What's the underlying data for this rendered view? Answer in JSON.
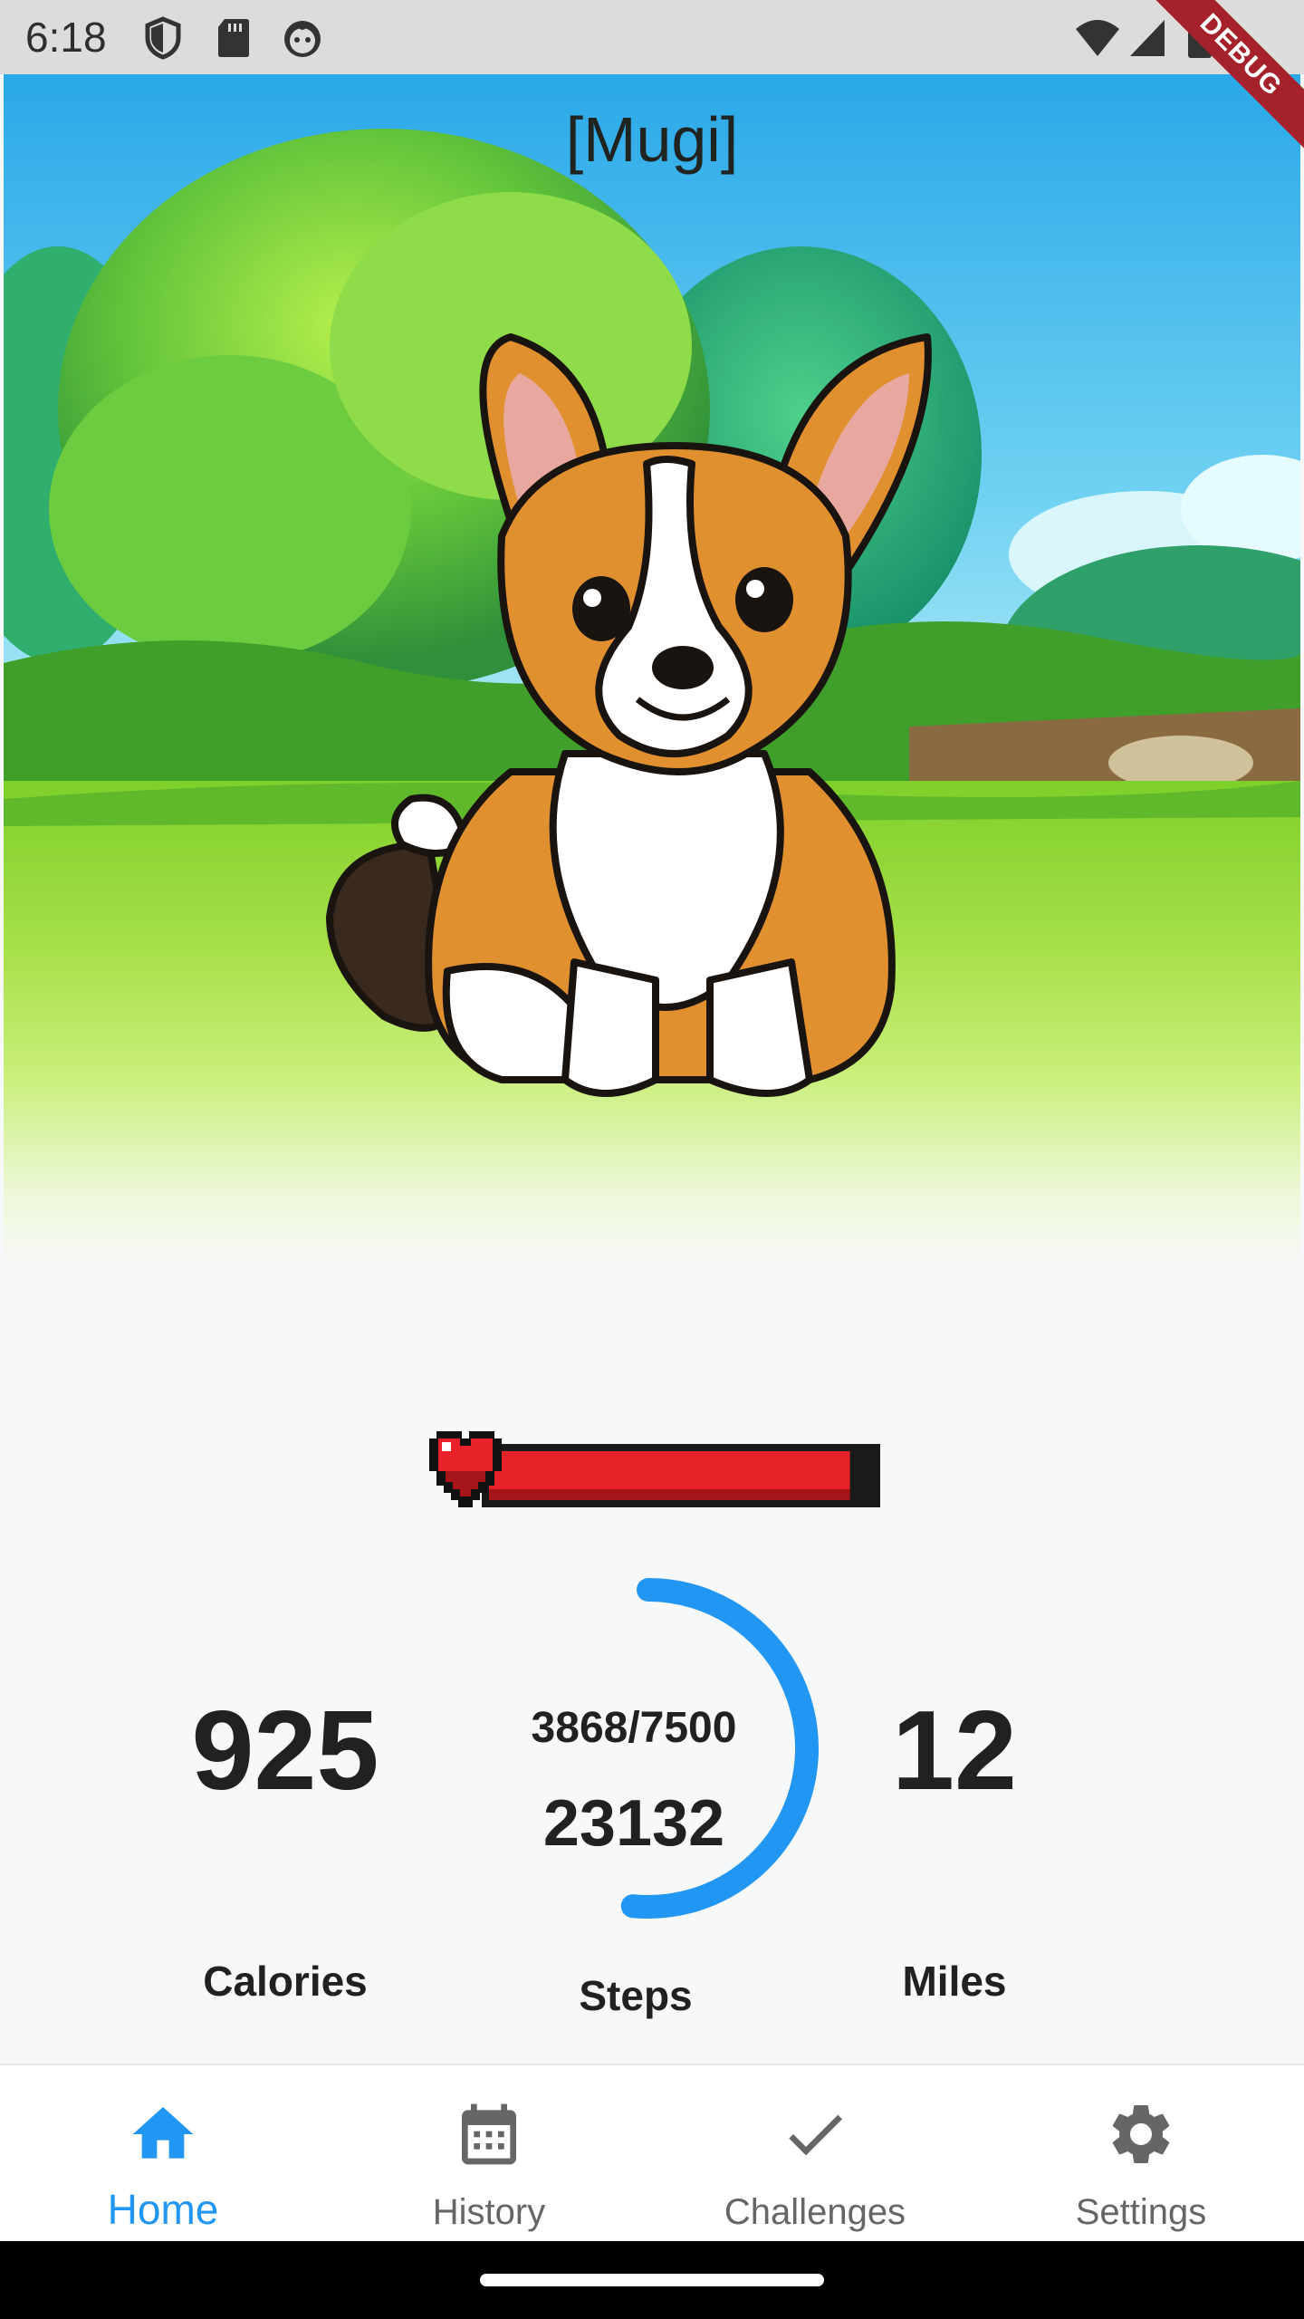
{
  "status_bar": {
    "time": "6:18",
    "debug_label": "DEBUG",
    "left_icons": [
      "shield-icon",
      "sd-card-icon",
      "face-icon"
    ],
    "right_icons": [
      "wifi-icon",
      "cell-signal-icon",
      "battery-icon"
    ]
  },
  "pet": {
    "name": "[Mugi]"
  },
  "health": {
    "fill_fraction": 0.94,
    "color": "#e82229"
  },
  "stats": {
    "calories": {
      "value": "925",
      "label": "Calories"
    },
    "steps": {
      "progress": "3868/7500",
      "total": "23132",
      "label": "Steps",
      "progress_fraction": 0.5157,
      "arc_color": "#2196f3"
    },
    "miles": {
      "value": "12",
      "label": "Miles"
    }
  },
  "nav": {
    "active_color": "#2196f3",
    "items": [
      {
        "label": "Home",
        "icon": "home-icon",
        "active": true
      },
      {
        "label": "History",
        "icon": "calendar-icon",
        "active": false
      },
      {
        "label": "Challenges",
        "icon": "check-icon",
        "active": false
      },
      {
        "label": "Settings",
        "icon": "gear-icon",
        "active": false
      }
    ]
  }
}
